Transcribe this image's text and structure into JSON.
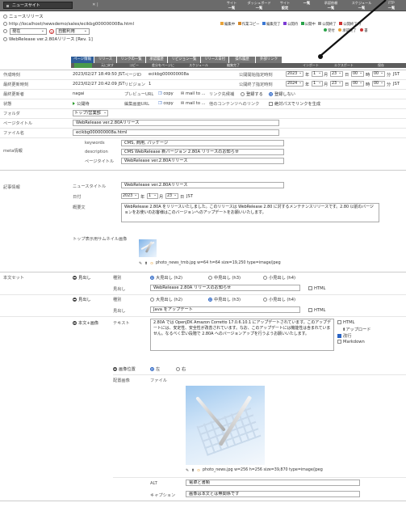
{
  "topbar": {
    "site_name": "ニュースサイト",
    "nav": [
      {
        "top": "サイト",
        "bottom": "一覧"
      },
      {
        "top": "ダッシュボード",
        "bottom": "一覧"
      },
      {
        "top": "サイト",
        "bottom": "設定"
      },
      {
        "top": "",
        "bottom": "一覧"
      },
      {
        "top": "承認依頼",
        "bottom": "一覧"
      },
      {
        "top": "スケジュール",
        "bottom": "一覧"
      },
      {
        "top": "FTP",
        "bottom": "一覧"
      }
    ]
  },
  "info": {
    "section": "ニュースリリース",
    "url": "http://localhost/newsdemo/sales/ecikbg000000008a.html",
    "version_select": "現在",
    "autosave_select": "自動利用",
    "title_line": "WebRelease ver.2.80Aリリース [Rev. 1]",
    "flags_row1": [
      "編集中",
      "作業コピー",
      "編集完了",
      "公開待",
      "公開中",
      "公開終了",
      "公開終了待"
    ],
    "flags_row2": [
      "受付",
      "承認完了",
      "書"
    ]
  },
  "tabs": [
    "ページ情報",
    "リリース",
    "リンクの一覧",
    "承認履歴",
    "リビジョン一覧",
    "リリース日付",
    "操作履歴",
    "外部リンク"
  ],
  "subtabs": [
    "",
    "元に戻す",
    "コピー",
    "差分をページに",
    "スケジュール",
    "編集完了",
    "インポート",
    "エクスポート",
    "保存"
  ],
  "form": {
    "created_label": "作成時刻",
    "created_value": "2023/02/27 18:49:50 JST",
    "page_id_label": "ページID",
    "page_id_value": "ecikbg000000008a",
    "pub_start_label": "公開開始指定時刻",
    "pub_start": {
      "year": "2023",
      "month": "1",
      "day": "23",
      "hour": "00",
      "minute": "00",
      "tz": "JST"
    },
    "updated_label": "最終更新時刻",
    "updated_value": "2023/02/27 20:42:09 JST",
    "revision_label": "リビジョン",
    "revision_value": "1",
    "pub_end_label": "公開終了指定時刻",
    "pub_end": {
      "year": "2024",
      "month": "1",
      "day": "23",
      "hour": "00",
      "minute": "00",
      "tz": "JST"
    },
    "editor_label": "最終更新者",
    "editor_value": "nagai",
    "preview_label": "プレビューURL",
    "copy_label": "copy",
    "mail_label": "mail to ...",
    "link_candidate_label": "リンク先候補",
    "register_label": "登録する",
    "no_register_label": "登録しない",
    "status_label": "状態",
    "status_value": "公開待",
    "edit_url_label": "編集画面URL",
    "other_content_label": "他のコンテンツへのリンク",
    "absolute_path_label": "絶対パスでリンクを生成",
    "folder_label": "フォルダ",
    "folder_value": "トップ/営業部",
    "page_title_label": "ページタイトル",
    "page_title_value": "WebRelease ver.2.80Aリリース",
    "filename_label": "ファイル名",
    "filename_value": "ecikbg000000008a.html",
    "meta_label": "meta情報",
    "keywords_label": "keywords",
    "keywords_value": "CMS, 商用, パッケージ",
    "description_label": "description",
    "description_value": "CMS WebRelease 新バージョン 2.80A リリースのお知らせ",
    "meta_pagetitle_label": "ページタイトル",
    "meta_pagetitle_value": "WebRelease ver.2.80Aリリース"
  },
  "article": {
    "section_label": "記事情報",
    "news_title_label": "ニュースタイトル",
    "news_title_value": "WebRelease ver.2.80Aリリース",
    "date_label": "日付",
    "date": {
      "year": "2023",
      "month": "1",
      "day": "23",
      "tz": "JST"
    },
    "summary_label": "概要文",
    "summary_value": "WebRelease 2.80A をリリースいたしました。このリリースは WebRelease 2.80 に対するメンテナンスリリースです。2.80 以前のバージョンをお使いのお客様はこのバージョンへのアップデートをお願いいたします。",
    "thumb_label": "トップ表示用サムネイル画像",
    "thumb_meta": "photo_news_tmb.jpg w=64 h=64 size=19,250 type=image/jpeg"
  },
  "body": {
    "section_label": "本文セット",
    "heading_label": "見出し",
    "kind_label": "種別",
    "h2": "大見出し (h2)",
    "h3": "中見出し (h3)",
    "h4": "小見出し (h4)",
    "html_label": "HTML",
    "heading1_value": "WebRelease 2.80A リリースのお知らせ",
    "heading2_value": "Java をアップデート",
    "body_image_label": "本文+画像",
    "text_label": "テキスト",
    "text_value": "2.80A では OpenJDK Amazon Corretto 17.0.6.10.1 にアップデートされています。このアップデートには、安定性、安全性が改善されています。なお、このアップデートには機能性は含まれていません。なるべく早い段階で 2.80A へのバージョンアップを行うようお願いいたします。",
    "text_options": [
      "HTML",
      "アップロード",
      "改行",
      "Markdown"
    ],
    "image_position_label": "画像位置",
    "left_label": "左",
    "right_label": "右",
    "placed_image_label": "配置画像",
    "file_label": "ファイル",
    "image_meta": "photo_news.jpg w=256 h=256 size=39,870 type=image/jpeg",
    "alt_label": "ALT",
    "alt_value": "電卓と書類",
    "caption_label": "キャプション",
    "caption_value": "画像は本文とは無関係です"
  }
}
